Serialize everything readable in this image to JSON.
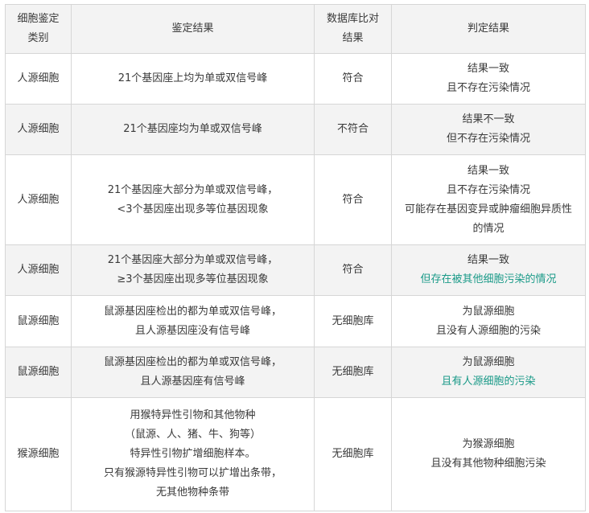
{
  "headers": {
    "category": [
      "细胞鉴定",
      "类别"
    ],
    "result": "鉴定结果",
    "db_compare": [
      "数据库比对",
      "结果"
    ],
    "judgement": "判定结果"
  },
  "rows": [
    {
      "category": "人源细胞",
      "result": [
        "21个基因座上均为单或双信号峰"
      ],
      "db": "符合",
      "judgement": [
        "结果一致",
        "且不存在污染情况"
      ],
      "highlight": []
    },
    {
      "category": "人源细胞",
      "result": [
        "21个基因座均为单或双信号峰"
      ],
      "db": "不符合",
      "judgement": [
        "结果不一致",
        "但不存在污染情况"
      ],
      "highlight": []
    },
    {
      "category": "人源细胞",
      "result": [
        "21个基因座大部分为单或双信号峰，",
        "<3个基因座出现多等位基因现象"
      ],
      "db": "符合",
      "judgement": [
        "结果一致",
        "且不存在污染情况",
        "可能存在基因变异或肿瘤细胞异质性",
        "的情况"
      ],
      "highlight": []
    },
    {
      "category": "人源细胞",
      "result": [
        "21个基因座大部分为单或双信号峰，",
        "≥3个基因座出现多等位基因现象"
      ],
      "db": "符合",
      "judgement": [
        "结果一致",
        "但存在被其他细胞污染的情况"
      ],
      "highlight": [
        1
      ]
    },
    {
      "category": "鼠源细胞",
      "result": [
        "鼠源基因座检出的都为单或双信号峰，",
        "且人源基因座没有信号峰"
      ],
      "db": "无细胞库",
      "judgement": [
        "为鼠源细胞",
        "且没有人源细胞的污染"
      ],
      "highlight": []
    },
    {
      "category": "鼠源细胞",
      "result": [
        "鼠源基因座检出的都为单或双信号峰，",
        "且人源基因座有信号峰"
      ],
      "db": "无细胞库",
      "judgement": [
        "为鼠源细胞",
        "且有人源细胞的污染"
      ],
      "highlight": [
        1
      ]
    },
    {
      "category": "猴源细胞",
      "result": [
        "用猴特异性引物和其他物种",
        "（鼠源、人、猪、牛、狗等）",
        "特异性引物扩增细胞样本。",
        "只有猴源特异性引物可以扩增出条带，",
        "无其他物种条带"
      ],
      "db": "无细胞库",
      "judgement": [
        "为猴源细胞",
        "且没有其他物种细胞污染"
      ],
      "highlight": []
    }
  ]
}
